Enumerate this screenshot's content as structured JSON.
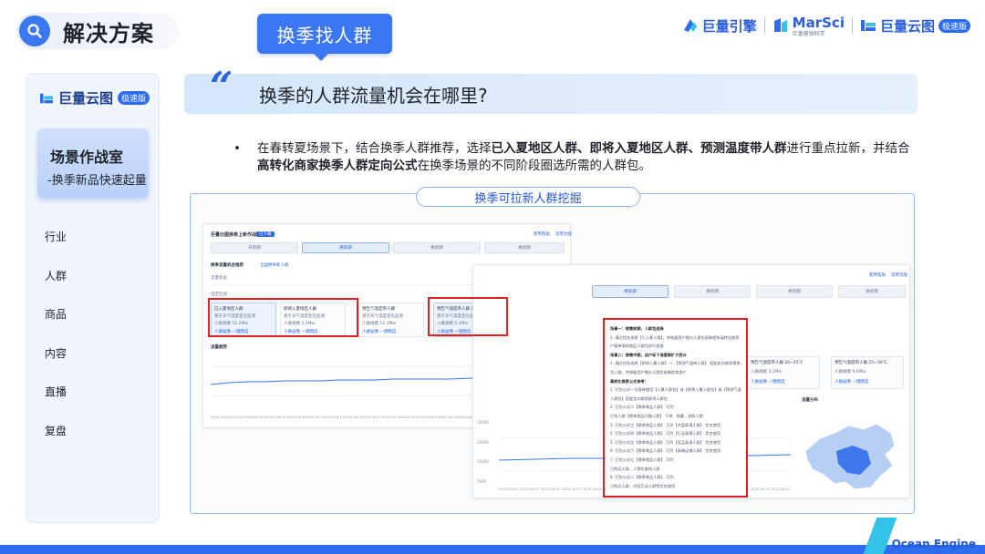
{
  "header": {
    "solution_title": "解决方案",
    "topic_tag": "换季找人群",
    "logos": [
      {
        "name": "巨量引擎"
      },
      {
        "name": "MarSci",
        "sub": "巨量营销科学"
      },
      {
        "name": "巨量云图",
        "badge": "极速版"
      }
    ]
  },
  "sidebar": {
    "logo": "巨量云图",
    "logo_badge": "极速版",
    "active_card": {
      "line1": "场景作战室",
      "line2": "-换季新品快速起量"
    },
    "items": [
      "行业",
      "人群",
      "商品",
      "内容",
      "直播",
      "复盘"
    ]
  },
  "question": "换季的人群流量机会在哪里?",
  "description": {
    "bullet": "•",
    "t1": "在春转夏场景下，结合换季人群推荐，选择",
    "b1": "已入夏地区人群、即将入夏地区人群、预测温度带人群",
    "t2": "进行重点拉新，并结合",
    "b2": "高转化商家换季人群定向公式",
    "t3": "在换季场景的不同阶段圈选所需的人群包。"
  },
  "screenshot_title": "换季可拉新人群挖掘",
  "mini_left": {
    "title": "巨量云图换季上新作战",
    "tag": "已下载",
    "top_links": [
      "使用帮助",
      "常用功能"
    ],
    "tabs": [
      "开新期",
      "换新期",
      "换新期",
      "换新期"
    ],
    "section": "换季流量机会推荐",
    "subsection": "流量机会",
    "filter_label": "选定区域",
    "filter_link": "全国换季新人群",
    "cards": [
      {
        "title": "已入夏地区人群",
        "desc": "基于天气温度变化监测",
        "count": "人群规模 55.2Mw",
        "actions": "人群画像 一键圈选"
      },
      {
        "title": "即将入夏地区人群",
        "desc": "基于天气温度变化监测",
        "count": "人群规模 3.2Mw",
        "actions": "人群画像 一键圈选"
      },
      {
        "title": "预告气温度带人群",
        "desc": "基于天气温度变化监测",
        "count": "人群规模 12.3Mw",
        "actions": "人群画像 一键圈选"
      },
      {
        "title": "预告气温度带人群 20~25℃",
        "desc": "基于天气温度变化监测",
        "count": "人群规模 5.4Mw",
        "actions": "人群画像 一键圈选"
      },
      {
        "title": "预告气温度带人群 25~30℃",
        "desc": "基于天气温度变化监测",
        "count": "人群规模 9.8Mw",
        "actions": "人群画像 一键圈选"
      }
    ],
    "trend_title": "流量趋势",
    "dates": [
      "2023-04-01",
      "2023-04-03",
      "2023-04-05",
      "2023-04-07",
      "2023-04-09",
      "2023-04-11",
      "2023-04-13",
      "2023-04-15",
      "2023-04-17",
      "2023-04-19",
      "2023-04-21",
      "2023-04-23",
      "2023-04-25",
      "2023-04-27"
    ]
  },
  "mini_right": {
    "top_links": [
      "使用帮助",
      "常用功能"
    ],
    "tabs": [
      "换新期",
      "换新期",
      "换新期",
      "换新期"
    ],
    "popup_lines": [
      "场景一：销售前期，人群包选择",
      "1. 通过优先选择【已入夏人群】，并根据用户细分人群包画像提炼高转化商家",
      "户客单高的商品人群包进行投放",
      "场景二：销售中期，店户标下准客群扩大受众",
      "1. 通过优先选择【即将入夏人群】 + 【预测气温带人群】 搭配定向商家换季人群",
      "包人群，并根据用户细分人群包画像提炼用户",
      "高转化商家公式参考：",
      "1. 打包公式一可直接使用【入夏人群包】或【即将入夏人群包】或【预测气温带",
      "人群包】搭配定向商家换季人群包",
      "2. 打包公式二【换季商品人群】 可为：",
      "打包人群【换季商品兴趣人群】 下单、收藏、加购人群",
      "3. 打包公式三【换季商品人群】 可为【大盘高潜人群】 交叉使用",
      "4. 打包公式四【换季商品人群】 可为【行业高潜人群】 交叉使用",
      "5. 打包公式五【换季商品人群】 可为【竞品高潜人群】 交叉使用",
      "6. 打包公式六【换季商品人群】 可为【高端店铺人群】 交叉使用",
      "7. 打包公式七【换季商品人群】 可为：",
      "已购买人群，人群包复购人群",
      "8. 打包公式八【换季商品人群】 可为：",
      "已购买人群，内容互动人群等交叉使用"
    ],
    "cards": [
      {
        "title": "预告气温度带人群 20~25℃",
        "count": "人群规模 3.2Mw",
        "actions": "人群画像 一键圈选"
      },
      {
        "title": "预告气温度带人群 25~30℃",
        "count": "人群规模 9.8Mw",
        "actions": "人群画像 一键圈选"
      }
    ],
    "map_title": "流量分布",
    "y_ticks": [
      "20000",
      "15000",
      "10000",
      "5000"
    ],
    "dates": [
      "2023-04-01",
      "2023-04-03",
      "2023-04-05",
      "2023-04-07",
      "2023-04-09",
      "2023-04-11",
      "2023-04-13",
      "2023-04-15",
      "2023-04-17",
      "2023-04-19",
      "2023-04-21",
      "2023-04-23",
      "2023-04-25",
      "2023-04-27"
    ]
  },
  "footer": {
    "brand": "Ocean Engine"
  },
  "colors": {
    "primary": "#3b77f3",
    "accent_red": "#e02121",
    "banner": "#d5e6fb"
  }
}
